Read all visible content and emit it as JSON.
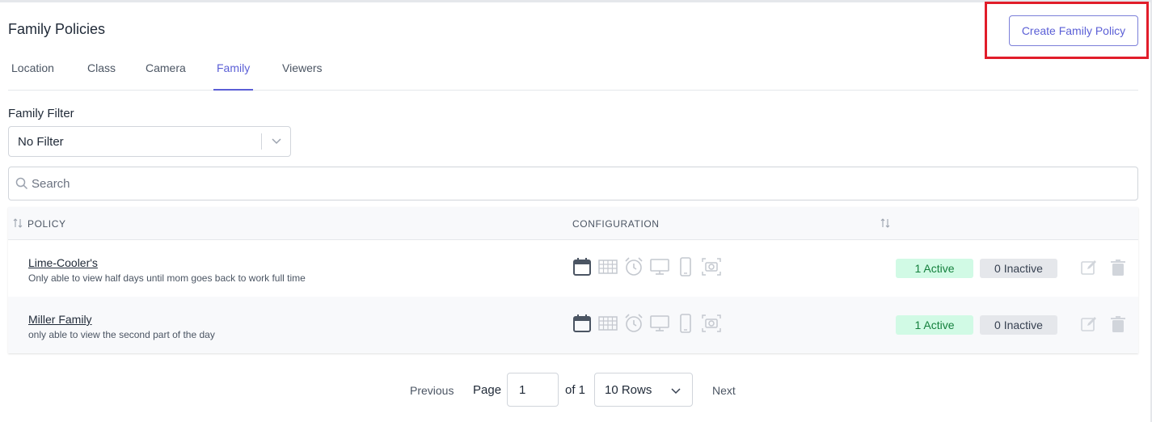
{
  "page": {
    "title": "Family Policies"
  },
  "header": {
    "create_button": "Create Family Policy"
  },
  "tabs": [
    {
      "label": "Location"
    },
    {
      "label": "Class"
    },
    {
      "label": "Camera"
    },
    {
      "label": "Family",
      "active": true
    },
    {
      "label": "Viewers"
    }
  ],
  "filter": {
    "label": "Family Filter",
    "value": "No Filter"
  },
  "search": {
    "placeholder": "Search",
    "value": ""
  },
  "table": {
    "columns": {
      "policy": "POLICY",
      "configuration": "CONFIGURATION"
    },
    "rows": [
      {
        "name": "Lime-Cooler's",
        "description": "Only able to view half days until mom goes back to work full time",
        "active": "1 Active",
        "inactive": "0 Inactive"
      },
      {
        "name": "Miller Family",
        "description": "only able to view the second part of the day",
        "active": "1 Active",
        "inactive": "0 Inactive"
      }
    ],
    "config_icons": [
      "calendar-icon",
      "schedule-grid-icon",
      "alarm-clock-icon",
      "monitor-icon",
      "mobile-phone-icon",
      "camera-icon"
    ]
  },
  "pagination": {
    "previous": "Previous",
    "page_label": "Page",
    "page_value": "1",
    "of_label": "of 1",
    "rows_value": "10 Rows",
    "next": "Next"
  },
  "colors": {
    "accent": "#5b5fd6",
    "highlight": "#e11d2a",
    "active_badge_bg": "#d1fae5",
    "active_badge_text": "#15803d",
    "inactive_badge_bg": "#e5e7eb"
  }
}
